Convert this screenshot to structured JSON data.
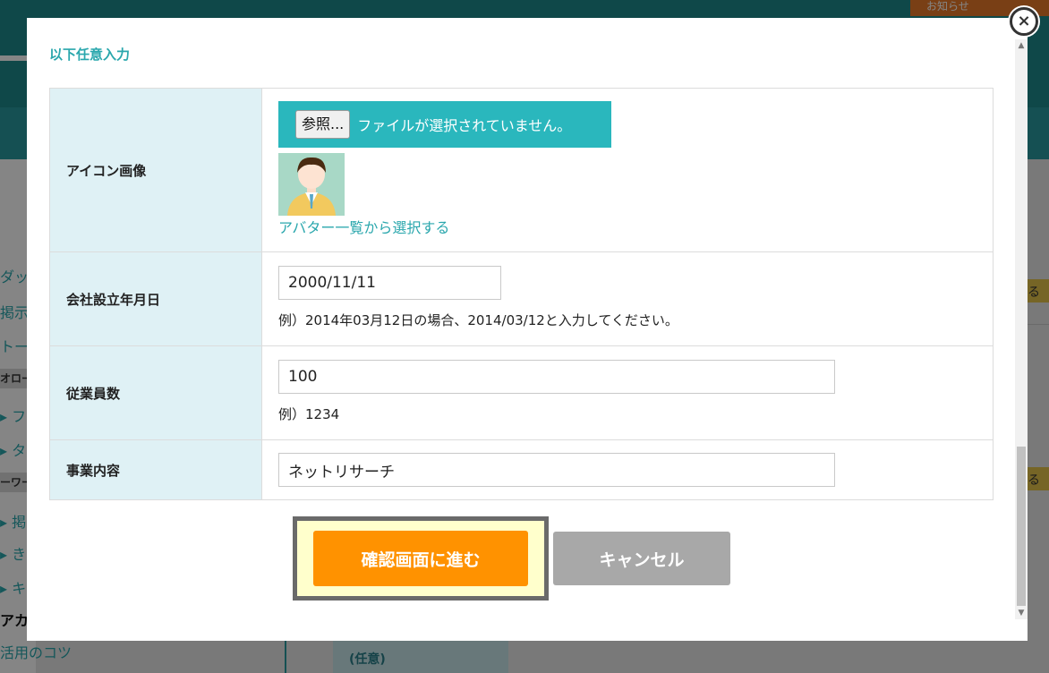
{
  "background": {
    "notice_label": "お知らせ",
    "side_items": [
      "ダッ",
      "掲示",
      "トー"
    ],
    "side_head1": "オロー",
    "side_items2": [
      "▸ フ",
      "▸ タ"
    ],
    "side_head2": "ーワー",
    "side_items3": [
      "▸ 掲",
      "▸ き",
      "▸ キ"
    ],
    "side_dark": "アカ",
    "bottom_link": "活用のコツ",
    "bottom_box": "(任意)",
    "right_badge": "る"
  },
  "modal": {
    "section_title": "以下任意入力",
    "close_icon": "×",
    "rows": {
      "icon": {
        "label": "アイコン画像",
        "file_button": "参照...",
        "file_status": "ファイルが選択されていません。",
        "avatar_link": "アバター一覧から選択する"
      },
      "founded": {
        "label": "会社設立年月日",
        "value": "2000/11/11",
        "hint": "例）2014年03月12日の場合、2014/03/12と入力してください。"
      },
      "employees": {
        "label": "従業員数",
        "value": "100",
        "hint": "例）1234"
      },
      "business": {
        "label": "事業内容",
        "value": "ネットリサーチ"
      }
    },
    "actions": {
      "confirm_label": "確認画面に進む",
      "cancel_label": "キャンセル"
    }
  },
  "colors": {
    "accent": "#2aa7ad",
    "primary_button": "#ff9200",
    "cancel_button": "#a8a8a8",
    "label_bg": "#dff1f5"
  }
}
